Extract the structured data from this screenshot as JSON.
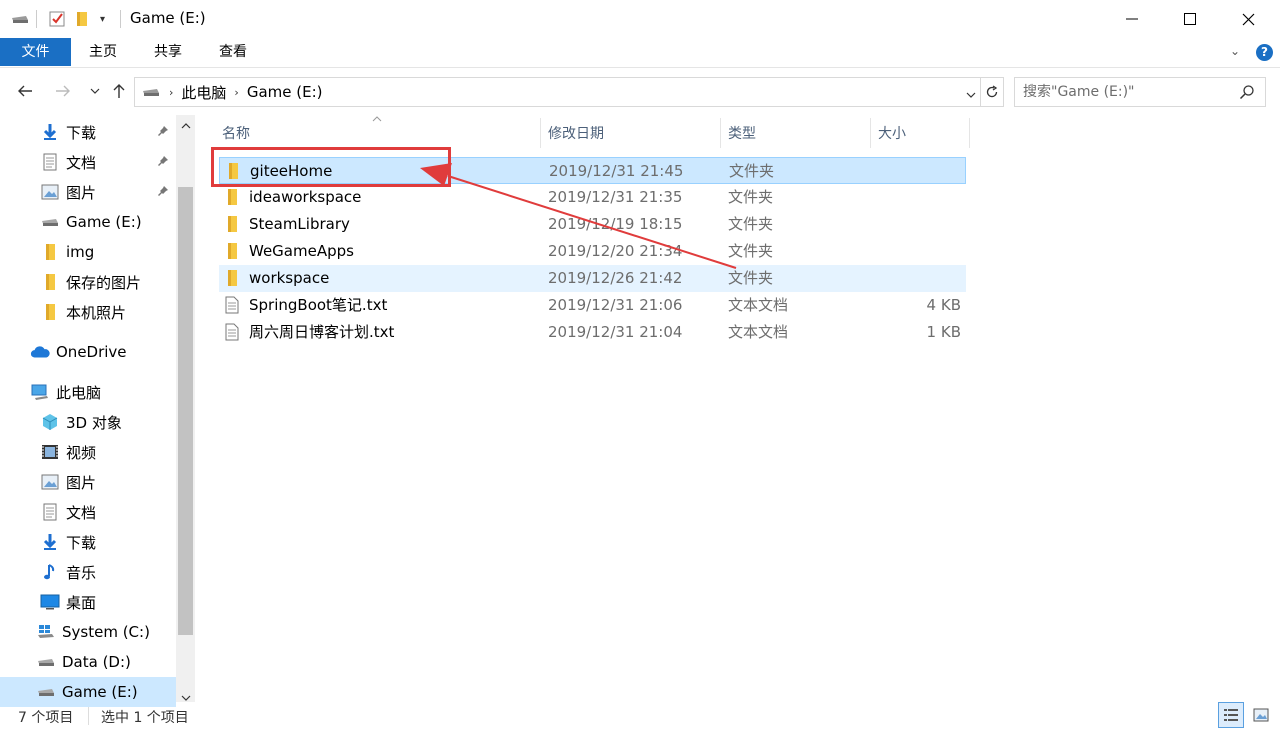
{
  "window": {
    "title": "Game (E:)",
    "minimize_glyph": "—",
    "maximize_glyph": "☐",
    "close_glyph": "✕"
  },
  "ribbon": {
    "tabs": [
      {
        "label": "文件"
      },
      {
        "label": "主页"
      },
      {
        "label": "共享"
      },
      {
        "label": "查看"
      }
    ]
  },
  "address": {
    "crumbs": [
      "此电脑",
      "Game (E:)"
    ],
    "search_placeholder": "搜索\"Game (E:)\""
  },
  "nav": {
    "items": [
      {
        "label": "下载",
        "icon": "download-icon",
        "pinned": true
      },
      {
        "label": "文档",
        "icon": "document-icon",
        "pinned": true
      },
      {
        "label": "图片",
        "icon": "pictures-icon",
        "pinned": true
      },
      {
        "label": "Game (E:)",
        "icon": "drive-icon"
      },
      {
        "label": "img",
        "icon": "folder-icon"
      },
      {
        "label": "保存的图片",
        "icon": "folder-icon"
      },
      {
        "label": "本机照片",
        "icon": "folder-icon"
      },
      {
        "label": "OneDrive",
        "icon": "cloud-icon"
      },
      {
        "label": "此电脑",
        "icon": "computer-icon"
      },
      {
        "label": "3D 对象",
        "icon": "cube-icon"
      },
      {
        "label": "视频",
        "icon": "video-icon"
      },
      {
        "label": "图片",
        "icon": "pictures-icon"
      },
      {
        "label": "文档",
        "icon": "document-icon"
      },
      {
        "label": "下载",
        "icon": "download-icon"
      },
      {
        "label": "音乐",
        "icon": "music-icon"
      },
      {
        "label": "桌面",
        "icon": "desktop-icon"
      },
      {
        "label": "System (C:)",
        "icon": "windows-drive-icon"
      },
      {
        "label": "Data (D:)",
        "icon": "drive-icon"
      },
      {
        "label": "Game (E:)",
        "icon": "drive-icon"
      }
    ]
  },
  "columns": {
    "name": "名称",
    "modified": "修改日期",
    "type": "类型",
    "size": "大小"
  },
  "files": [
    {
      "name": "giteeHome",
      "modified": "2019/12/31 21:45",
      "type": "文件夹",
      "size": "",
      "icon": "folder-icon"
    },
    {
      "name": "ideaworkspace",
      "modified": "2019/12/31 21:35",
      "type": "文件夹",
      "size": "",
      "icon": "folder-icon"
    },
    {
      "name": "SteamLibrary",
      "modified": "2019/12/19 18:15",
      "type": "文件夹",
      "size": "",
      "icon": "folder-icon"
    },
    {
      "name": "WeGameApps",
      "modified": "2019/12/20 21:34",
      "type": "文件夹",
      "size": "",
      "icon": "folder-icon"
    },
    {
      "name": "workspace",
      "modified": "2019/12/26 21:42",
      "type": "文件夹",
      "size": "",
      "icon": "folder-icon"
    },
    {
      "name": "SpringBoot笔记.txt",
      "modified": "2019/12/31 21:06",
      "type": "文本文档",
      "size": "4 KB",
      "icon": "text-file-icon"
    },
    {
      "name": "周六周日博客计划.txt",
      "modified": "2019/12/31 21:04",
      "type": "文本文档",
      "size": "1 KB",
      "icon": "text-file-icon"
    }
  ],
  "status": {
    "count": "7 个项目",
    "selected": "选中 1 个项目"
  },
  "colors": {
    "accent": "#1a6fc4",
    "selection": "#cce8ff",
    "annotation": "#e03c3c",
    "folder": "#f5c842"
  }
}
